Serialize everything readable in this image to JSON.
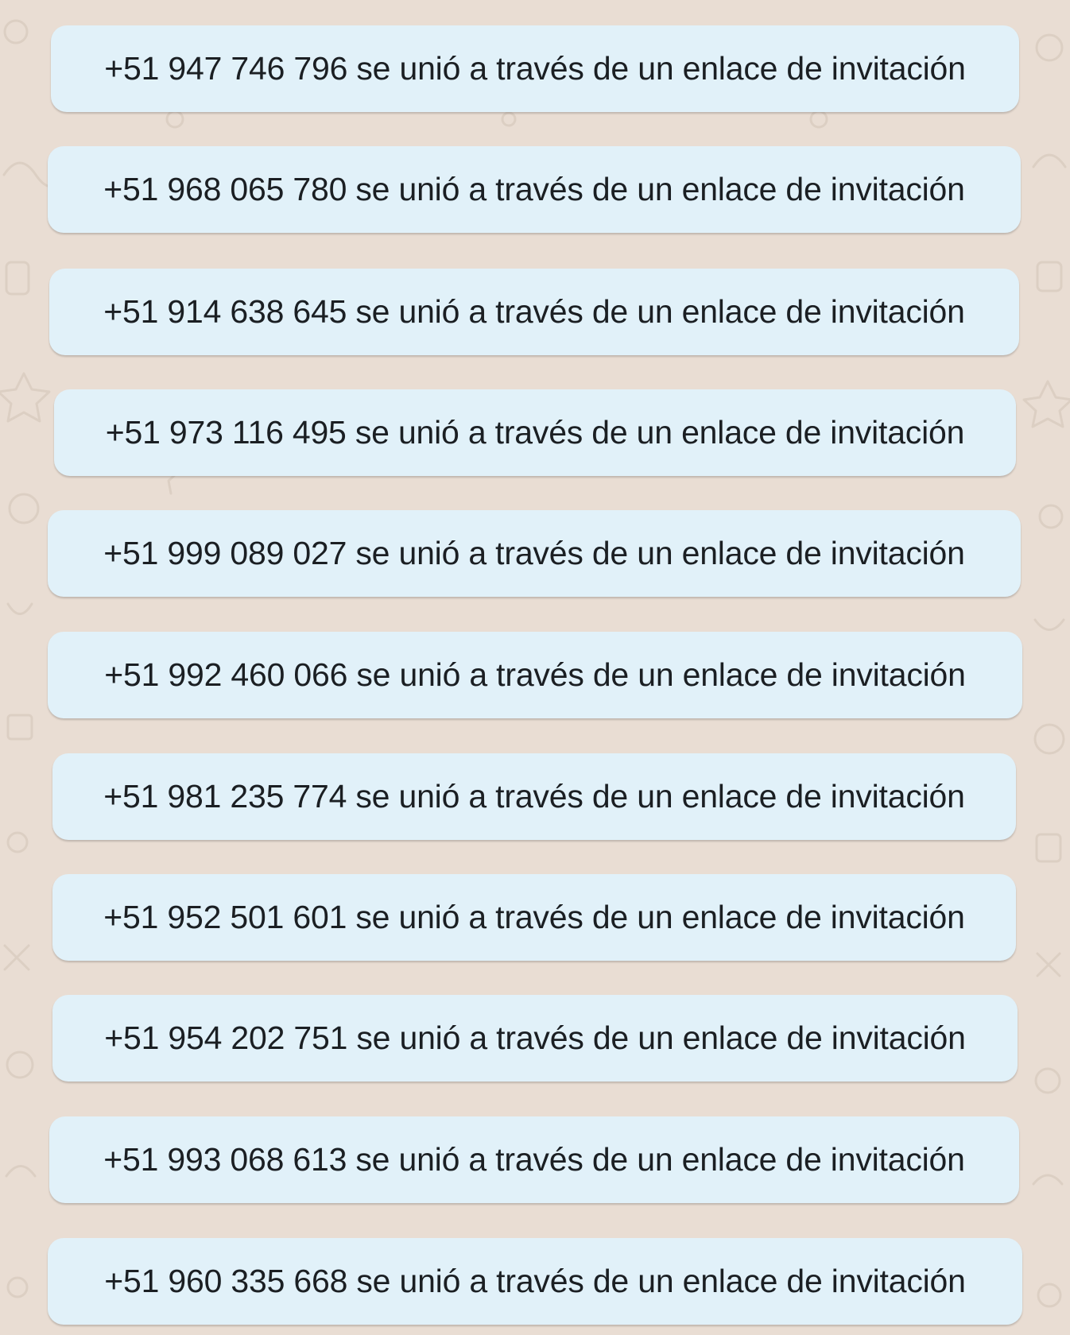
{
  "colors": {
    "background": "#e9ddd3",
    "bubble": "#e1f1f9",
    "text": "#1b1f23",
    "doodle": "#d9cbbf"
  },
  "system_messages": [
    {
      "phone": "+51 947 746 796",
      "text": "+51 947 746 796 se unió a través de un enlace de invitación"
    },
    {
      "phone": "+51 968 065 780",
      "text": "+51 968 065 780 se unió a través de un enlace de invitación"
    },
    {
      "phone": "+51 914 638 645",
      "text": "+51 914 638 645 se unió a través de un enlace de invitación"
    },
    {
      "phone": "+51 973 116 495",
      "text": "+51 973 116 495 se unió a través de un enlace de invitación"
    },
    {
      "phone": "+51 999 089 027",
      "text": "+51 999 089 027 se unió a través de un enlace de invitación"
    },
    {
      "phone": "+51 992 460 066",
      "text": "+51 992 460 066 se unió a través de un enlace de invitación"
    },
    {
      "phone": "+51 981 235 774",
      "text": "+51 981 235 774 se unió a través de un enlace de invitación"
    },
    {
      "phone": "+51 952 501 601",
      "text": "+51 952 501 601 se unió a través de un enlace de invitación"
    },
    {
      "phone": "+51 954 202 751",
      "text": "+51 954 202 751 se unió a través de un enlace de invitación"
    },
    {
      "phone": "+51 993 068 613",
      "text": "+51 993 068 613 se unió a través de un enlace de invitación"
    },
    {
      "phone": "+51 960 335 668",
      "text": "+51 960 335 668 se unió a través de un enlace de invitación"
    }
  ]
}
